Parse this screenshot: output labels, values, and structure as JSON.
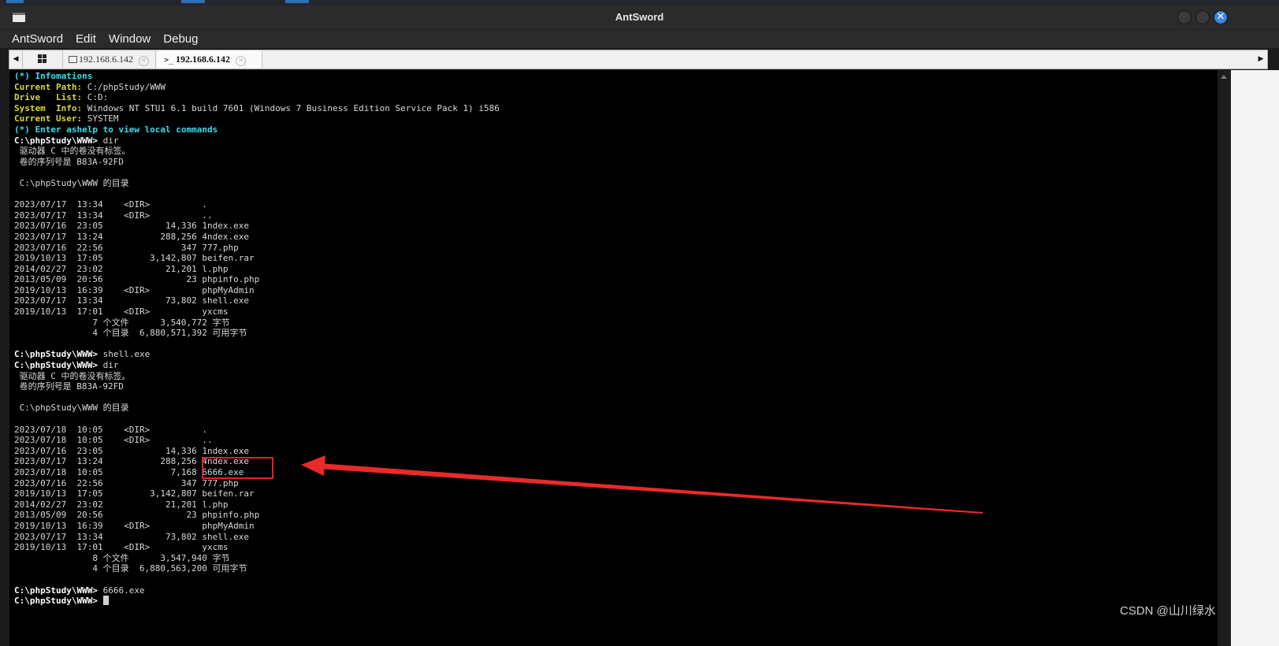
{
  "window": {
    "title": "AntSword"
  },
  "menu": [
    "AntSword",
    "Edit",
    "Window",
    "Debug"
  ],
  "tabs": [
    {
      "label": "192.168.6.142",
      "icon": "folder-icon"
    },
    {
      "label": "192.168.6.142",
      "icon": "terminal-prompt-icon",
      "active": true
    }
  ],
  "colors": {
    "cyan": "#35e0f0",
    "yellow": "#d8d83a",
    "annotation_red": "#e32222",
    "close_button": "#3b86e0"
  },
  "terminal": {
    "lines": [
      [
        [
          "(*) Infomations",
          "cyan"
        ]
      ],
      [
        [
          "Current Path: ",
          "yel"
        ],
        [
          "C:/phpStudy/WWW",
          ""
        ]
      ],
      [
        [
          "Drive   List: ",
          "yel"
        ],
        [
          "C:D:",
          ""
        ]
      ],
      [
        [
          "System  Info: ",
          "yel"
        ],
        [
          "Windows NT STU1 6.1 build 7601 (Windows 7 Business Edition Service Pack 1) i586",
          ""
        ]
      ],
      [
        [
          "Current User: ",
          "yel"
        ],
        [
          "SYSTEM",
          ""
        ]
      ],
      [
        [
          "(*) Enter ashelp to view local commands",
          "cyan"
        ]
      ],
      [
        [
          "C:\\phpStudy\\WWW> ",
          "wht"
        ],
        [
          "dir",
          ""
        ]
      ],
      [
        [
          " 驱动器 C 中的卷没有标签。",
          ""
        ]
      ],
      [
        [
          " 卷的序列号是 B83A-92FD",
          ""
        ]
      ],
      [
        [
          "",
          ""
        ]
      ],
      [
        [
          " C:\\phpStudy\\WWW 的目录",
          ""
        ]
      ],
      [
        [
          "",
          ""
        ]
      ],
      [
        [
          "2023/07/17  13:34    <DIR>          .",
          ""
        ]
      ],
      [
        [
          "2023/07/17  13:34    <DIR>          ..",
          ""
        ]
      ],
      [
        [
          "2023/07/16  23:05            14,336 1ndex.exe",
          ""
        ]
      ],
      [
        [
          "2023/07/17  13:24           288,256 4ndex.exe",
          ""
        ]
      ],
      [
        [
          "2023/07/16  22:56               347 777.php",
          ""
        ]
      ],
      [
        [
          "2019/10/13  17:05         3,142,807 beifen.rar",
          ""
        ]
      ],
      [
        [
          "2014/02/27  23:02            21,201 l.php",
          ""
        ]
      ],
      [
        [
          "2013/05/09  20:56                23 phpinfo.php",
          ""
        ]
      ],
      [
        [
          "2019/10/13  16:39    <DIR>          phpMyAdmin",
          ""
        ]
      ],
      [
        [
          "2023/07/17  13:34            73,802 shell.exe",
          ""
        ]
      ],
      [
        [
          "2019/10/13  17:01    <DIR>          yxcms",
          ""
        ]
      ],
      [
        [
          "               7 个文件      3,540,772 字节",
          ""
        ]
      ],
      [
        [
          "               4 个目录  6,880,571,392 可用字节",
          ""
        ]
      ],
      [
        [
          "",
          ""
        ]
      ],
      [
        [
          "C:\\phpStudy\\WWW> ",
          "wht"
        ],
        [
          "shell.exe",
          ""
        ]
      ],
      [
        [
          "C:\\phpStudy\\WWW> ",
          "wht"
        ],
        [
          "dir",
          ""
        ]
      ],
      [
        [
          " 驱动器 C 中的卷没有标签。",
          ""
        ]
      ],
      [
        [
          " 卷的序列号是 B83A-92FD",
          ""
        ]
      ],
      [
        [
          "",
          ""
        ]
      ],
      [
        [
          " C:\\phpStudy\\WWW 的目录",
          ""
        ]
      ],
      [
        [
          "",
          ""
        ]
      ],
      [
        [
          "2023/07/18  10:05    <DIR>          .",
          ""
        ]
      ],
      [
        [
          "2023/07/18  10:05    <DIR>          ..",
          ""
        ]
      ],
      [
        [
          "2023/07/16  23:05            14,336 1ndex.exe",
          ""
        ]
      ],
      [
        [
          "2023/07/17  13:24           288,256 4ndex.exe",
          ""
        ]
      ],
      [
        [
          "2023/07/18  10:05             7,168 6666.exe",
          ""
        ]
      ],
      [
        [
          "2023/07/16  22:56               347 777.php",
          ""
        ]
      ],
      [
        [
          "2019/10/13  17:05         3,142,807 beifen.rar",
          ""
        ]
      ],
      [
        [
          "2014/02/27  23:02            21,201 l.php",
          ""
        ]
      ],
      [
        [
          "2013/05/09  20:56                23 phpinfo.php",
          ""
        ]
      ],
      [
        [
          "2019/10/13  16:39    <DIR>          phpMyAdmin",
          ""
        ]
      ],
      [
        [
          "2023/07/17  13:34            73,802 shell.exe",
          ""
        ]
      ],
      [
        [
          "2019/10/13  17:01    <DIR>          yxcms",
          ""
        ]
      ],
      [
        [
          "               8 个文件      3,547,940 字节",
          ""
        ]
      ],
      [
        [
          "               4 个目录  6,880,563,200 可用字节",
          ""
        ]
      ],
      [
        [
          "",
          ""
        ]
      ],
      [
        [
          "C:\\phpStudy\\WWW> ",
          "wht"
        ],
        [
          "6666.exe",
          ""
        ]
      ],
      [
        [
          "C:\\phpStudy\\WWW> ",
          "wht"
        ]
      ]
    ]
  },
  "watermark": "CSDN @山川绿水"
}
